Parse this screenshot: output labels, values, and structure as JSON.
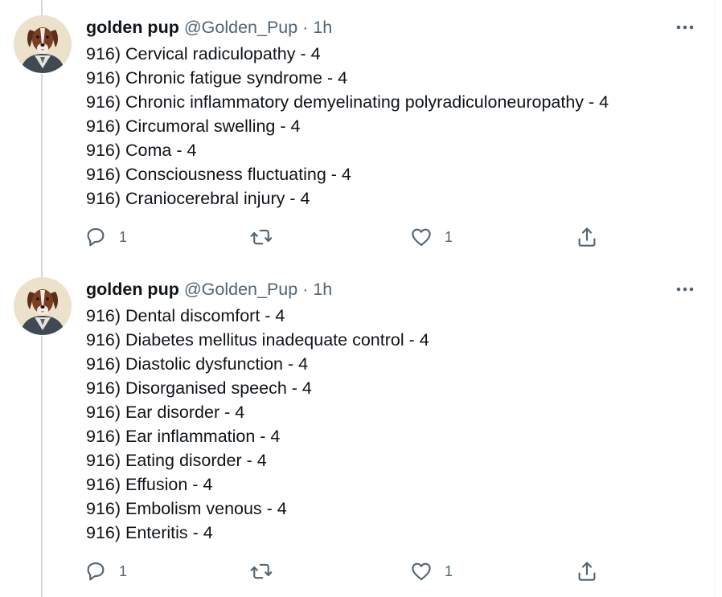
{
  "tweets": [
    {
      "author": {
        "name": "golden pup",
        "handle": "@Golden_Pup",
        "separator": "·",
        "time": "1h",
        "avatar_icon": "dog-portrait-avatar"
      },
      "lines": [
        "916) Cervical radiculopathy - 4",
        "916) Chronic fatigue syndrome - 4",
        "916) Chronic inflammatory demyelinating polyradiculoneuropathy - 4",
        "916) Circumoral swelling - 4",
        "916) Coma - 4",
        "916) Consciousness fluctuating - 4",
        "916) Craniocerebral injury - 4"
      ],
      "actions": {
        "reply_icon": "reply-icon",
        "reply_count": "1",
        "retweet_icon": "retweet-icon",
        "retweet_count": "",
        "like_icon": "heart-icon",
        "like_count": "1",
        "share_icon": "share-icon"
      }
    },
    {
      "author": {
        "name": "golden pup",
        "handle": "@Golden_Pup",
        "separator": "·",
        "time": "1h",
        "avatar_icon": "dog-portrait-avatar"
      },
      "lines": [
        "916) Dental discomfort - 4",
        "916) Diabetes mellitus inadequate control - 4",
        "916) Diastolic dysfunction - 4",
        "916) Disorganised speech - 4",
        "916) Ear disorder - 4",
        "916) Ear inflammation - 4",
        "916) Eating disorder - 4",
        "916) Effusion - 4",
        "916) Embolism venous - 4",
        "916) Enteritis - 4"
      ],
      "actions": {
        "reply_icon": "reply-icon",
        "reply_count": "1",
        "retweet_icon": "retweet-icon",
        "retweet_count": "",
        "like_icon": "heart-icon",
        "like_count": "1",
        "share_icon": "share-icon"
      }
    }
  ],
  "colors": {
    "text": "#0f1419",
    "secondary": "#536471",
    "thread_line": "#cfd9de",
    "border": "#eff3f4"
  }
}
